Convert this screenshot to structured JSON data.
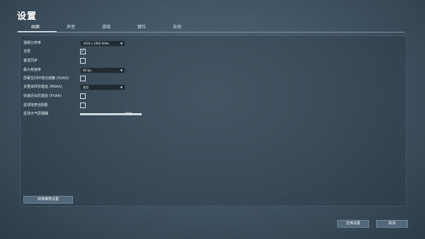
{
  "window": {
    "title": "设置"
  },
  "tabs": [
    {
      "label": "画面"
    },
    {
      "label": "声音"
    },
    {
      "label": "游戏"
    },
    {
      "label": "键位"
    },
    {
      "label": "杂项"
    }
  ],
  "settings": {
    "resolution": {
      "label": "视频分辨率",
      "value": "1920 x 1080  60Hz"
    },
    "fullscreen": {
      "label": "全屏",
      "checked": true
    },
    "vsync": {
      "label": "垂直同步",
      "checked": false
    },
    "max_fps": {
      "label": "最大帧速率",
      "value": "60 fps"
    },
    "ssao": {
      "label": "屏幕空间环境光遮蔽 (SSAO)",
      "checked": false
    },
    "msaa": {
      "label": "多重采样抗锯齿 (MSAA)",
      "value": "禁用"
    },
    "fxaa": {
      "label": "快速近似抗锯齿 (FXAA)",
      "checked": false
    },
    "planet_shadows": {
      "label": "星球地表自阴影",
      "checked": false
    },
    "atmosphere_blur": {
      "label": "星球大气层模糊",
      "value_text": "100%",
      "level": 1.0
    }
  },
  "buttons": {
    "recommended": "转换推荐设置",
    "apply": "应用设置",
    "cancel": "取消"
  },
  "icons": {
    "check": "check-icon",
    "dropdown": "chevron-down-icon"
  }
}
